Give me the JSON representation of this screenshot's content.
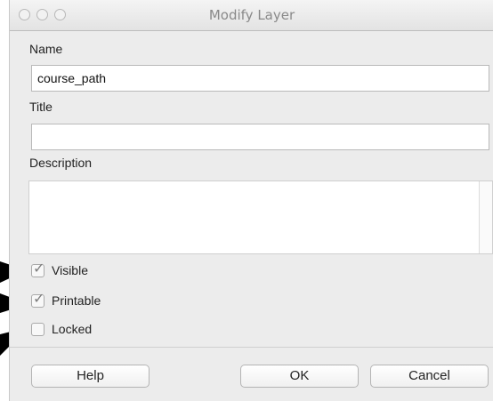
{
  "window": {
    "title": "Modify Layer"
  },
  "form": {
    "name_label": "Name",
    "name_value": "course_path",
    "title_label": "Title",
    "title_value": "",
    "description_label": "Description",
    "description_value": ""
  },
  "checkboxes": [
    {
      "label": "Visible",
      "checked": true
    },
    {
      "label": "Printable",
      "checked": true
    },
    {
      "label": "Locked",
      "checked": false
    }
  ],
  "buttons": {
    "help": "Help",
    "ok": "OK",
    "cancel": "Cancel"
  },
  "checkmark_glyph": "✓",
  "colors": {
    "window_bg": "#ececec",
    "arrow": "#000000"
  }
}
